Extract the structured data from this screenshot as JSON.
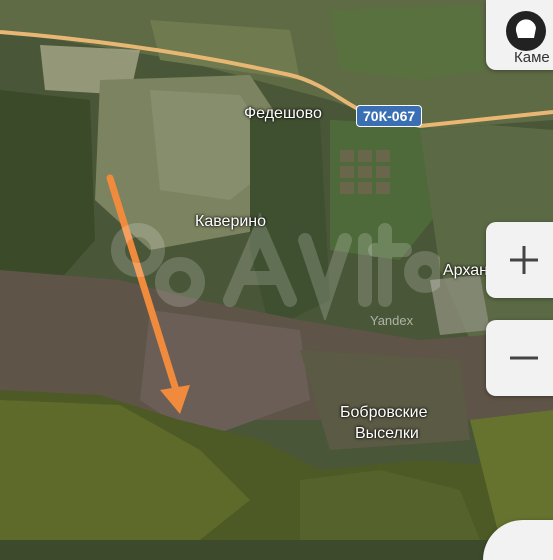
{
  "map": {
    "places": {
      "fedeshovo": "Федешово",
      "kaverino": "Каверино",
      "arkhangelsk": "Архангельс",
      "bobrovskie_line1": "Бобровские",
      "bobrovskie_line2": "Выселки",
      "kame": "Каме"
    },
    "road_badge": "70К-067",
    "provider": "Yandex",
    "colors": {
      "road": "#e9b774",
      "arrow": "#f08a3c",
      "badge": "#3b6fb4"
    }
  },
  "controls": {
    "zoom_in": "+",
    "zoom_out": "−"
  }
}
